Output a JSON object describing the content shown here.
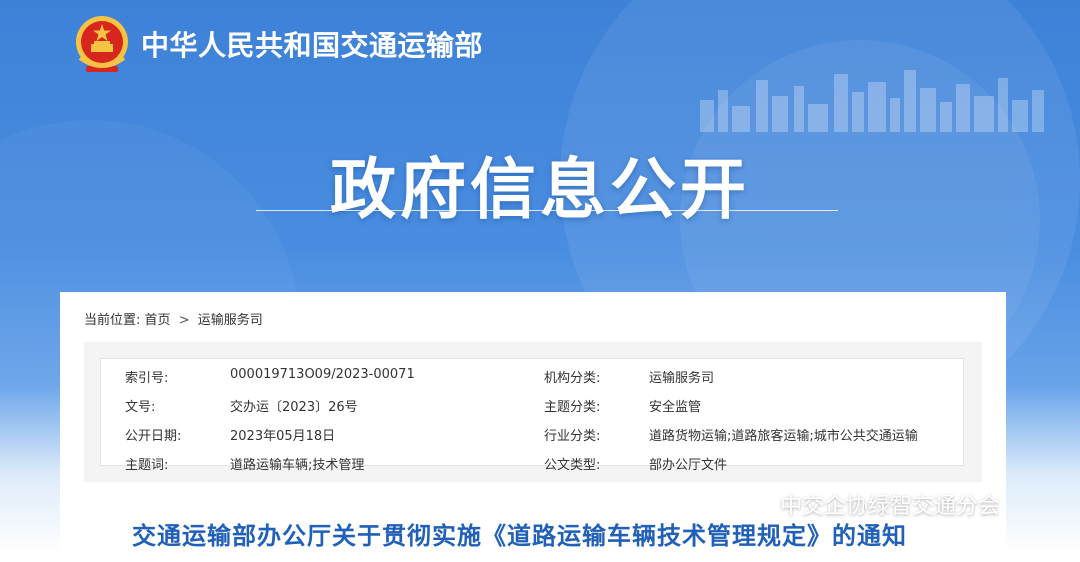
{
  "header": {
    "site_name": "中华人民共和国交通运输部",
    "banner_title": "政府信息公开"
  },
  "breadcrumb": {
    "label": "当前位置:",
    "items": [
      "首页",
      "运输服务司"
    ],
    "separator": ">"
  },
  "metadata": [
    {
      "k1": "索引号:",
      "v1": "000019713O09/2023-00071",
      "k2": "机构分类:",
      "v2": "运输服务司"
    },
    {
      "k1": "文号:",
      "v1": "交办运〔2023〕26号",
      "k2": "主题分类:",
      "v2": "安全监管"
    },
    {
      "k1": "公开日期:",
      "v1": "2023年05月18日",
      "k2": "行业分类:",
      "v2": "道路货物运输;道路旅客运输;城市公共交通运输"
    },
    {
      "k1": "主题词:",
      "v1": "道路运输车辆;技术管理",
      "k2": "公文类型:",
      "v2": "部办公厅文件"
    }
  ],
  "document": {
    "title": "交通运输部办公厅关于贯彻实施《道路运输车辆技术管理规定》的通知"
  },
  "watermark": {
    "text": "中交企协绿智交通分会",
    "icon": "wechat-icon"
  },
  "colors": {
    "banner_blue": "#3d82d8",
    "title_blue": "#2060b8",
    "emblem_red": "#d7261e",
    "emblem_gold": "#f6c343"
  }
}
